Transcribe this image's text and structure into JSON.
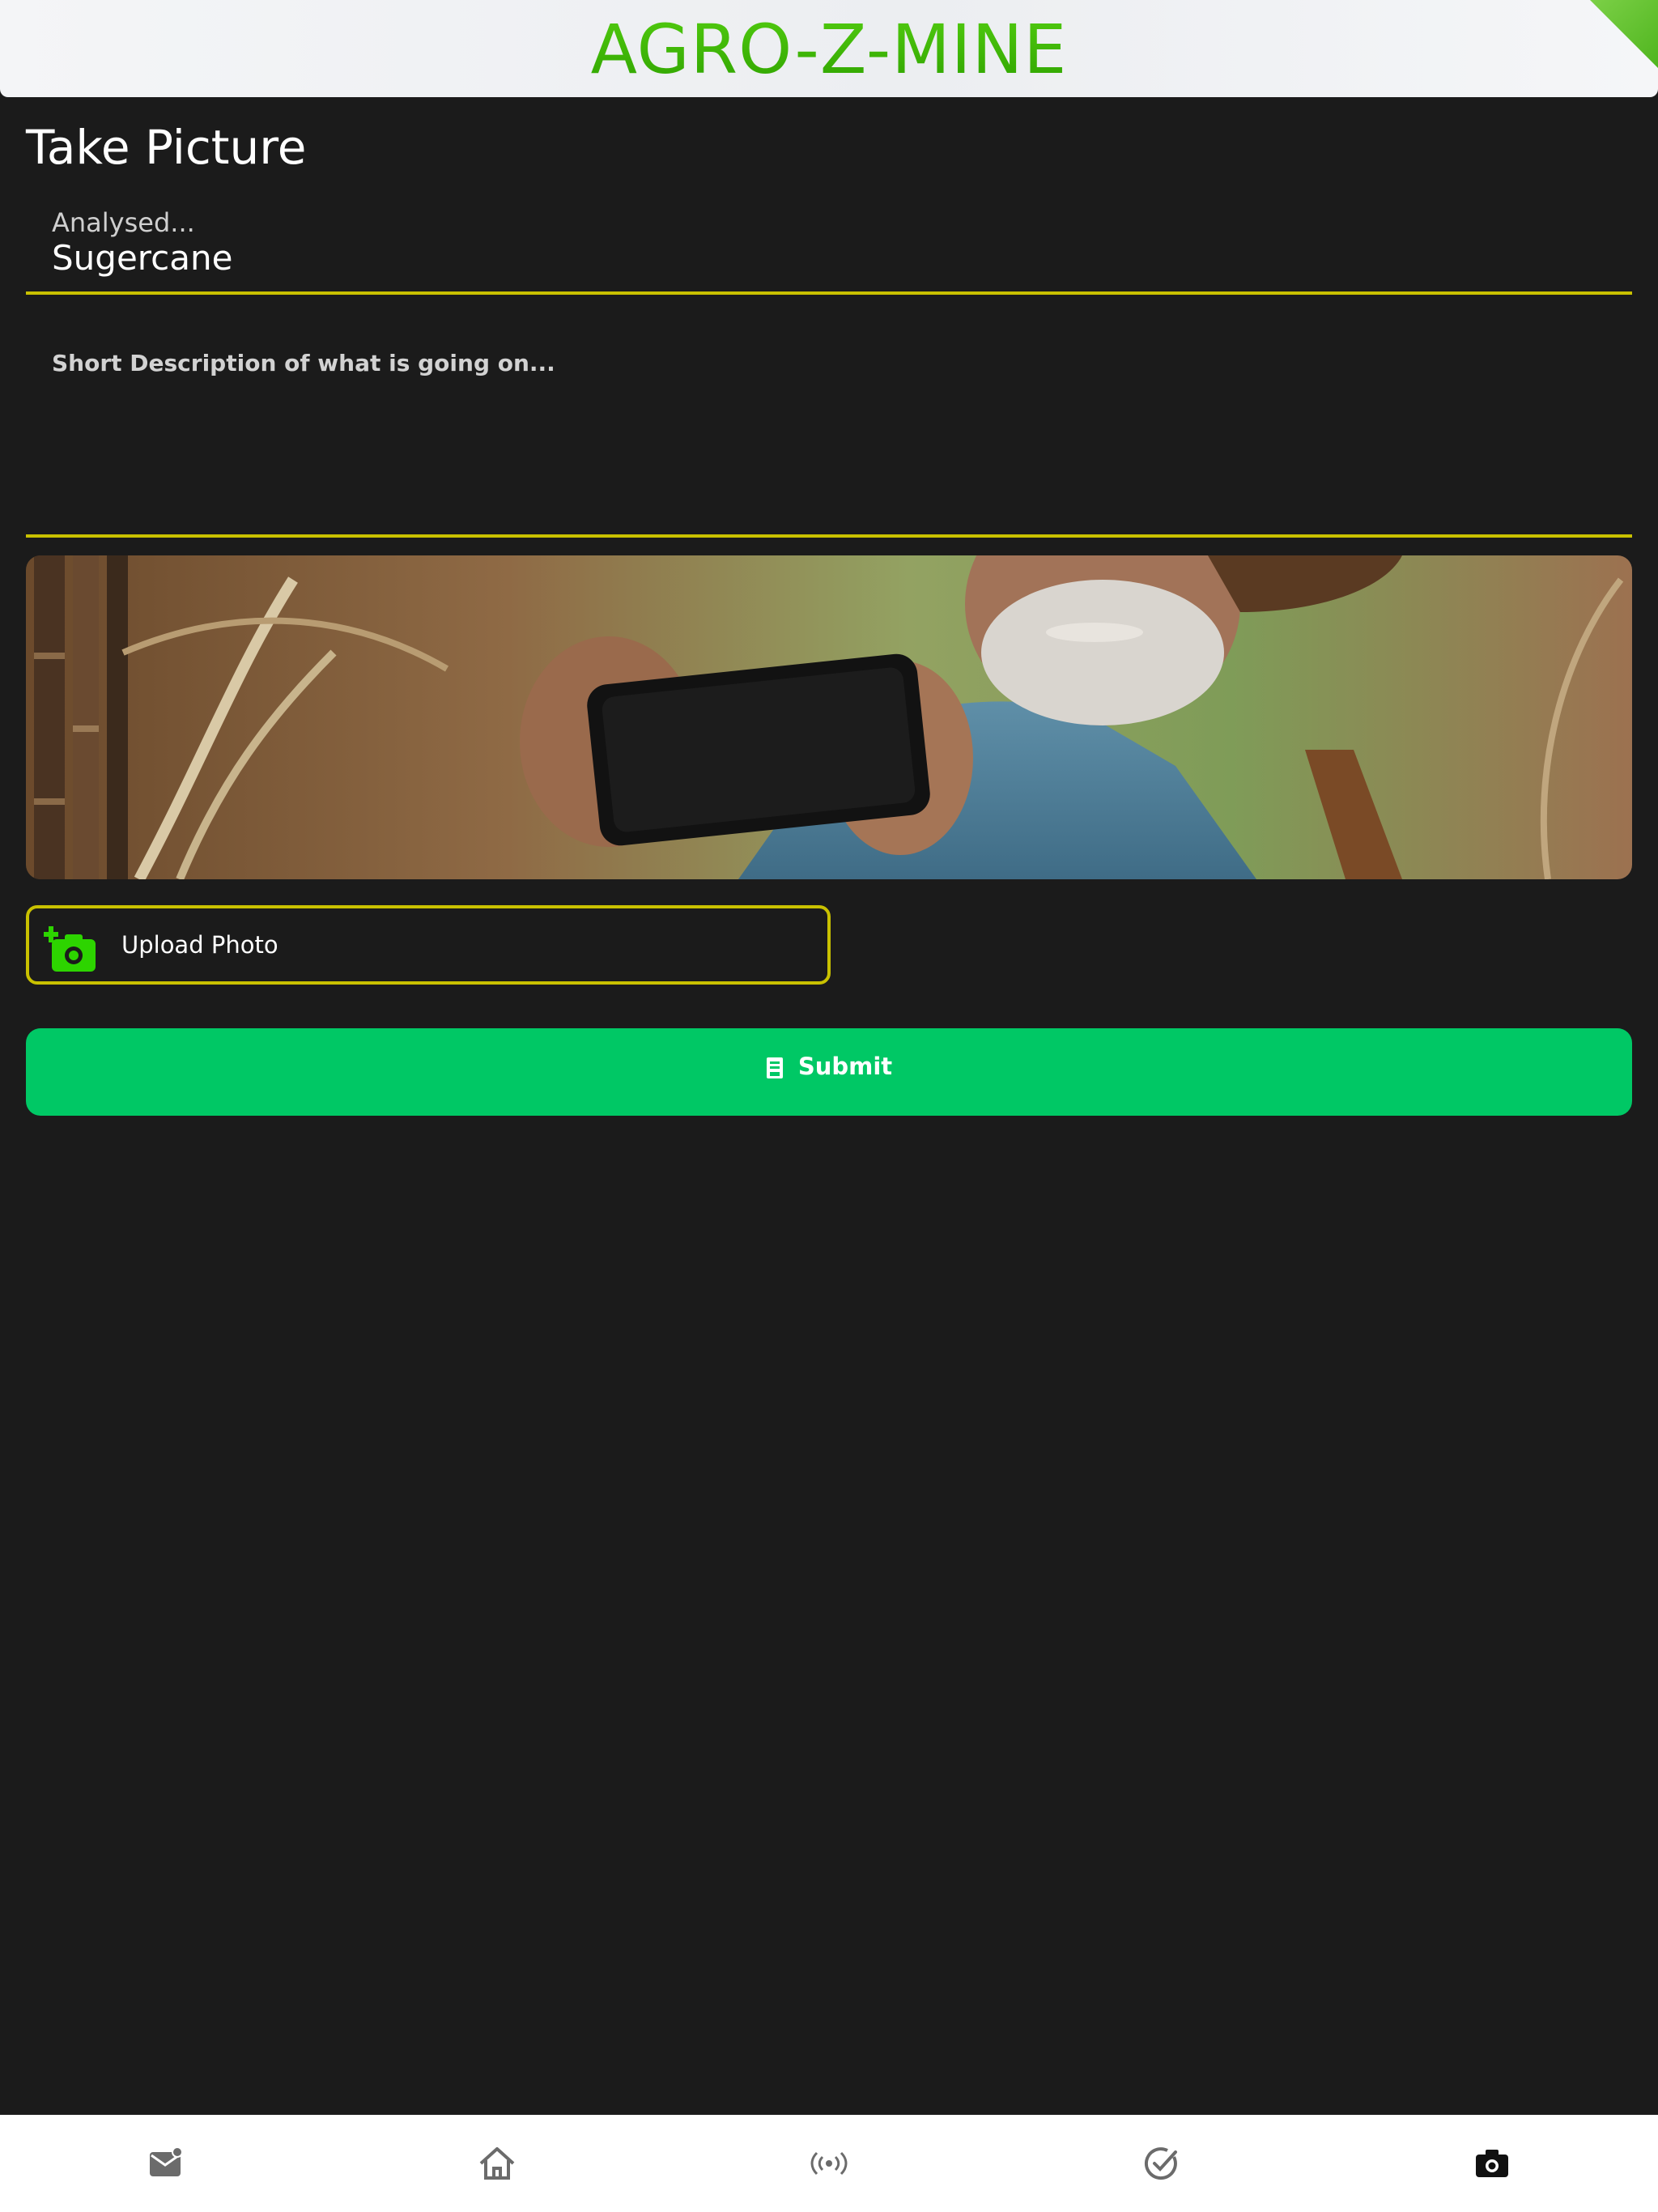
{
  "header": {
    "title": "AGRO-Z-MINE"
  },
  "page": {
    "title": "Take Picture"
  },
  "form": {
    "crop_field": {
      "label": "Analysed...",
      "value": "Sugercane"
    },
    "description_field": {
      "placeholder": "Short Description of what is going on..."
    },
    "upload_label": "Upload Photo",
    "submit_label": "Submit"
  },
  "bottom_nav": {
    "items": [
      {
        "icon": "mail-badge-icon",
        "selected": false
      },
      {
        "icon": "home-icon",
        "selected": false
      },
      {
        "icon": "broadcast-icon",
        "selected": false
      },
      {
        "icon": "check-circle-icon",
        "selected": false
      },
      {
        "icon": "camera-icon",
        "selected": true
      }
    ]
  },
  "colors": {
    "brand_green": "#3cb40a",
    "accent_yellow": "#c9c100",
    "submit_green": "#00c865",
    "background": "#1b1b1b"
  }
}
